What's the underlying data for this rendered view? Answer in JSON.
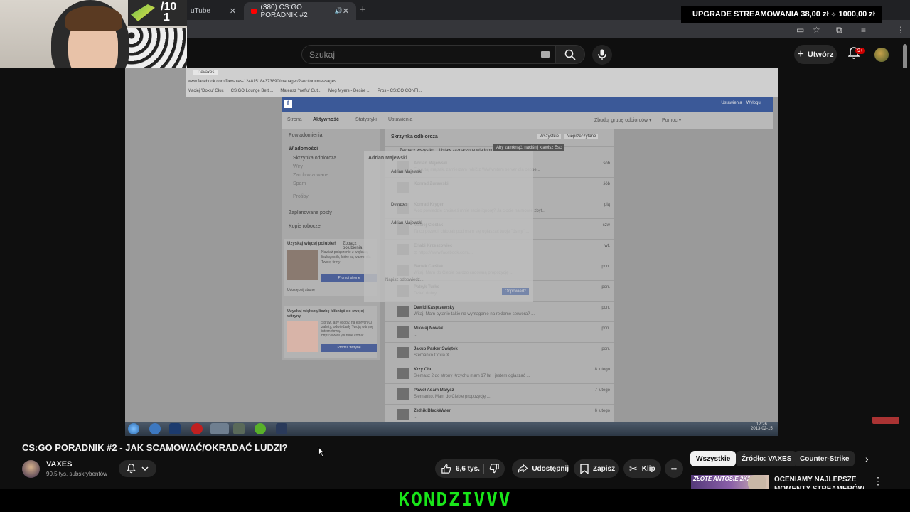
{
  "browser": {
    "tabs": [
      {
        "label": "uTube"
      },
      {
        "label": "(380) CS:GO PORADNIK #2"
      }
    ],
    "new_tab": "+"
  },
  "upgrade": {
    "text": "UPGRADE STREAMOWANIA 38,00 zł",
    "sep": "⟡",
    "target": "1000,00 zł"
  },
  "webcam_score": {
    "line1": "/10",
    "line2": "1"
  },
  "youtube": {
    "search_placeholder": "Szukaj",
    "create_label": "Utwórz",
    "notif_count": "9+"
  },
  "video": {
    "fb_url": "www.facebook.com/Devaxes-124815184373890/manager/?section=messages",
    "fb_tab": "Devaxes",
    "bookmarks": [
      "Maciej 'Doxiu' Głuc",
      "CS:GO Lounge Betti...",
      "Mateusz 'mefiu' Gut...",
      "Meg Myers - Desire ...",
      "Pros - CS:GO CONFI..."
    ],
    "fb_top_links": [
      "Ustawienia",
      "Wyloguj"
    ],
    "fb_tabs": [
      "Strona",
      "Aktywność",
      "Statystyki",
      "Ustawienia"
    ],
    "fb_tabs_right": [
      "Zbuduj grupę odbiorców ▾",
      "Pomoc ▾"
    ],
    "fb_left": {
      "items": [
        "Powiadomienia",
        "Wiadomości",
        "Skrzynka odbiorcza",
        "Wiry",
        "Zarchiwizowane",
        "Spam",
        "Prośby",
        "Zaplanowane posty",
        "Kopie robocze"
      ],
      "promo1_title": "Uzyskaj więcej polubień",
      "promo1_link": "Zobacz polubienia",
      "promo1_text": "Nawiąż połączenie z większą liczbą osób, które są ważne dla Twojej firmy",
      "promo1_button": "Promuj stronę",
      "promo1_footer": "Udostępnij stronę",
      "promo2_title": "Uzyskaj większą liczbę kliknięć do swojej witryny",
      "promo2_text": "Spraw, aby osoby, na których Ci zależy, odwiedzały Twoją witrynę internetową. https://www.youtube.com/c...",
      "promo2_button": "Promuj witrynę"
    },
    "fb_main": {
      "header": "Skrzynka odbiorcza",
      "filters": [
        "Wszystkie",
        "Nieprzeczytane"
      ],
      "subfilters": [
        "Zaznacz wszystko",
        "Ustaw zaznaczone wiadomości jako..."
      ],
      "tooltip": "Aby zamknąć, naciśnij klawisz Esc",
      "rows": [
        {
          "name": "Adrian Majewski",
          "text": "Ela tutaj majsak, zamierzam robić z WWwmtem server dla osobe...",
          "date": "śób"
        },
        {
          "name": "Konrad Żurawski",
          "text": "...",
          "date": "śób"
        },
        {
          "name": "Konrad Kryger",
          "text": "A co powiedzie chciałeś mnie sexie ignorę? Ja ciocie na mowie zbyt...",
          "date": "pią"
        },
        {
          "name": "Maciej Cieślak",
          "text": "Ta co pozwoli chłopak pod mam się ogłaszać twoje \"ósmy\" ...",
          "date": "czw"
        },
        {
          "name": "Eriabi Krzeszowiec",
          "text": "⊙ https://www.facebook.com/...",
          "date": "wt."
        },
        {
          "name": "Bartek Cieślak",
          "text": "Witaj, Mam do Ciebie bardzo cudowną propozycję ...",
          "date": "pon."
        },
        {
          "name": "Patryk Turko",
          "text": "Dzień dobry...",
          "date": "pon."
        },
        {
          "name": "Dawid Kasprzewsky",
          "text": "Witaj, Mam pytanie takie na wymaganie na reklamę serwera? ...",
          "date": "pon."
        },
        {
          "name": "Mikołaj Nowak",
          "text": "...",
          "date": "pon."
        },
        {
          "name": "Jakub Parker Świątek",
          "text": "Stemanko Coxia X",
          "date": "pon."
        },
        {
          "name": "Krzy Chu",
          "text": "Siemasz 2 do strony Krzychu mam 17 lat i jestem ogłaszać ...",
          "date": "8 lutego"
        },
        {
          "name": "Paweł Adam Małysz",
          "text": "Siemanko. Mam do Ciebie propozycję ...",
          "date": "7 lutego"
        },
        {
          "name": "Zethik BlackWater",
          "text": "...",
          "date": "6 lutego"
        }
      ]
    },
    "fb_modal": {
      "title": "Adrian Majewski",
      "lines": [
        "Adrian Majewski",
        "Devaxes",
        "Adrian Majewski"
      ],
      "reply_placeholder": "Napisz odpowiedź...",
      "send": "Odpowiedz"
    },
    "clock_time": "12:26",
    "clock_date": "2013-02-15"
  },
  "video_info": {
    "title": "CS:GO PORADNIK #2 - JAK SCAMOWAĆ/OKRADAĆ LUDZI?",
    "channel": "VAXES",
    "subscribers": "90,5 tys. subskrybentów",
    "likes": "6,6 tys.",
    "share": "Udostępnij",
    "save": "Zapisz",
    "clip": "Klip",
    "more": "•••"
  },
  "chips": [
    "Wszystkie",
    "Źródło: VAXES",
    "Counter-Strike"
  ],
  "recommendation": {
    "thumb_text": "ZŁOTE ANTOSIE 2K25",
    "title": "OCENIAMY NAJLEPSZE MOMENTY STREAMERÓW Z"
  },
  "brand": "KONDZIVVV",
  "colors": {
    "brand_green": "#19e619",
    "yt_red": "#cc0000",
    "fb_blue": "#3b5998"
  }
}
